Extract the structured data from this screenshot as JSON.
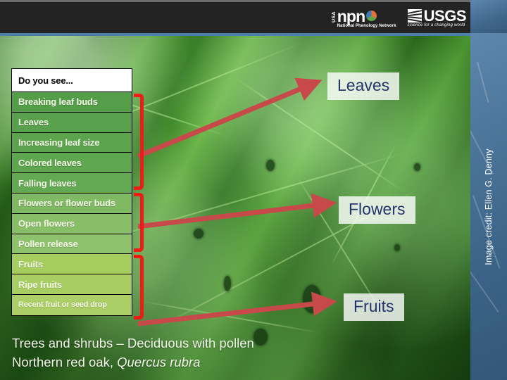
{
  "header": {
    "npn_logo": {
      "usa": "USA",
      "wordmark": "npn",
      "subtitle": "National Phenology Network",
      "circle_colors": [
        "#e8703a",
        "#5fa748",
        "#3f7ab5"
      ]
    },
    "usgs_logo": {
      "wordmark": "USGS",
      "tagline": "science for a changing world"
    }
  },
  "checklist": {
    "header_label": "Do you see...",
    "rows": [
      {
        "label": "Breaking leaf buds",
        "color": "#549e4a",
        "group": "leaves"
      },
      {
        "label": "Leaves",
        "color": "#58a04c",
        "group": "leaves"
      },
      {
        "label": "Increasing leaf size",
        "color": "#5ca34e",
        "group": "leaves"
      },
      {
        "label": "Colored leaves",
        "color": "#5fa650",
        "group": "leaves"
      },
      {
        "label": "Falling leaves",
        "color": "#63a953",
        "group": "leaves"
      },
      {
        "label": "Flowers or flower buds",
        "color": "#7fb964",
        "group": "flowers"
      },
      {
        "label": "Open flowers",
        "color": "#88be68",
        "group": "flowers"
      },
      {
        "label": "Pollen release",
        "color": "#8dc16b",
        "group": "flowers"
      },
      {
        "label": "Fruits",
        "color": "#a5cc5e",
        "group": "fruits"
      },
      {
        "label": "Ripe fruits",
        "color": "#a8cd62",
        "group": "fruits"
      },
      {
        "label": "Recent fruit or seed drop",
        "color": "#abcf66",
        "group": "fruits"
      }
    ],
    "bracket_color": "#ee1b16",
    "header_text_color": "#000000",
    "row_text_color": "#f3f7e6"
  },
  "callouts": [
    {
      "label": "Leaves",
      "group": "leaves"
    },
    {
      "label": "Flowers",
      "group": "flowers"
    },
    {
      "label": "Fruits",
      "group": "fruits"
    }
  ],
  "caption": {
    "line1": "Trees and shrubs – Deciduous with pollen",
    "line2_prefix": "Northern red oak, ",
    "line2_scientific": "Quercus rubra"
  },
  "credit": {
    "text": "Image credit: Ellen G. Denny"
  },
  "colors": {
    "arrow_red": "#c8494a",
    "bracket_red": "#ee1b16",
    "callout_text": "#23356b",
    "header_bar": "#232323",
    "blue_panel": "#4a7398"
  }
}
